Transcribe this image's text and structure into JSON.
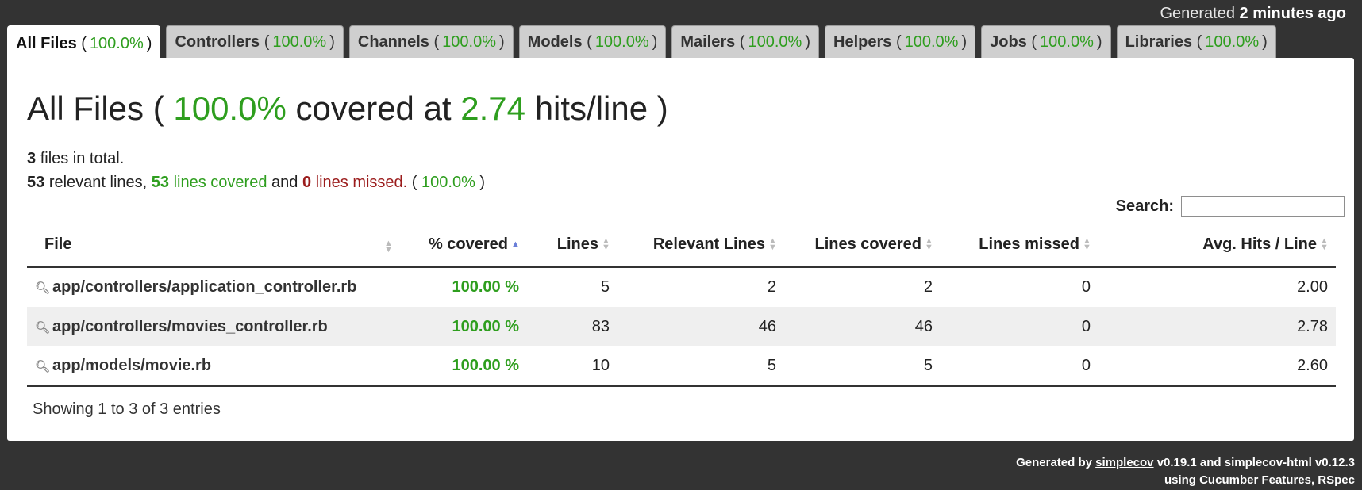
{
  "timestamp": {
    "prefix": "Generated",
    "value": "2 minutes ago"
  },
  "tabs": [
    {
      "name": "All Files",
      "pct": "100.0%"
    },
    {
      "name": "Controllers",
      "pct": "100.0%"
    },
    {
      "name": "Channels",
      "pct": "100.0%"
    },
    {
      "name": "Models",
      "pct": "100.0%"
    },
    {
      "name": "Mailers",
      "pct": "100.0%"
    },
    {
      "name": "Helpers",
      "pct": "100.0%"
    },
    {
      "name": "Jobs",
      "pct": "100.0%"
    },
    {
      "name": "Libraries",
      "pct": "100.0%"
    }
  ],
  "title": {
    "group": "All Files",
    "pct": "100.0%",
    "mid": "covered at",
    "hits": "2.74",
    "unit": "hits/line"
  },
  "summary": {
    "files_total": "3",
    "files_text": "files in total.",
    "relevant": "53",
    "relevant_text": "relevant lines,",
    "covered": "53",
    "covered_text": "lines covered",
    "and_text": "and",
    "missed": "0",
    "missed_text": "lines missed.",
    "pct": "100.0%"
  },
  "search": {
    "label": "Search:",
    "value": ""
  },
  "table": {
    "headers": {
      "file": "File",
      "covered": "% covered",
      "lines": "Lines",
      "relevant": "Relevant Lines",
      "lines_covered": "Lines covered",
      "missed": "Lines missed",
      "avg": "Avg. Hits / Line"
    },
    "rows": [
      {
        "file": "app/controllers/application_controller.rb",
        "covered": "100.00 %",
        "lines": "5",
        "relevant": "2",
        "lines_covered": "2",
        "missed": "0",
        "avg": "2.00"
      },
      {
        "file": "app/controllers/movies_controller.rb",
        "covered": "100.00 %",
        "lines": "83",
        "relevant": "46",
        "lines_covered": "46",
        "missed": "0",
        "avg": "2.78"
      },
      {
        "file": "app/models/movie.rb",
        "covered": "100.00 %",
        "lines": "10",
        "relevant": "5",
        "lines_covered": "5",
        "missed": "0",
        "avg": "2.60"
      }
    ]
  },
  "entries": "Showing 1 to 3 of 3 entries",
  "footer": {
    "generated_by": "Generated by",
    "link": "simplecov",
    "rest": "v0.19.1 and simplecov-html v0.12.3",
    "line2": "using Cucumber Features, RSpec"
  }
}
